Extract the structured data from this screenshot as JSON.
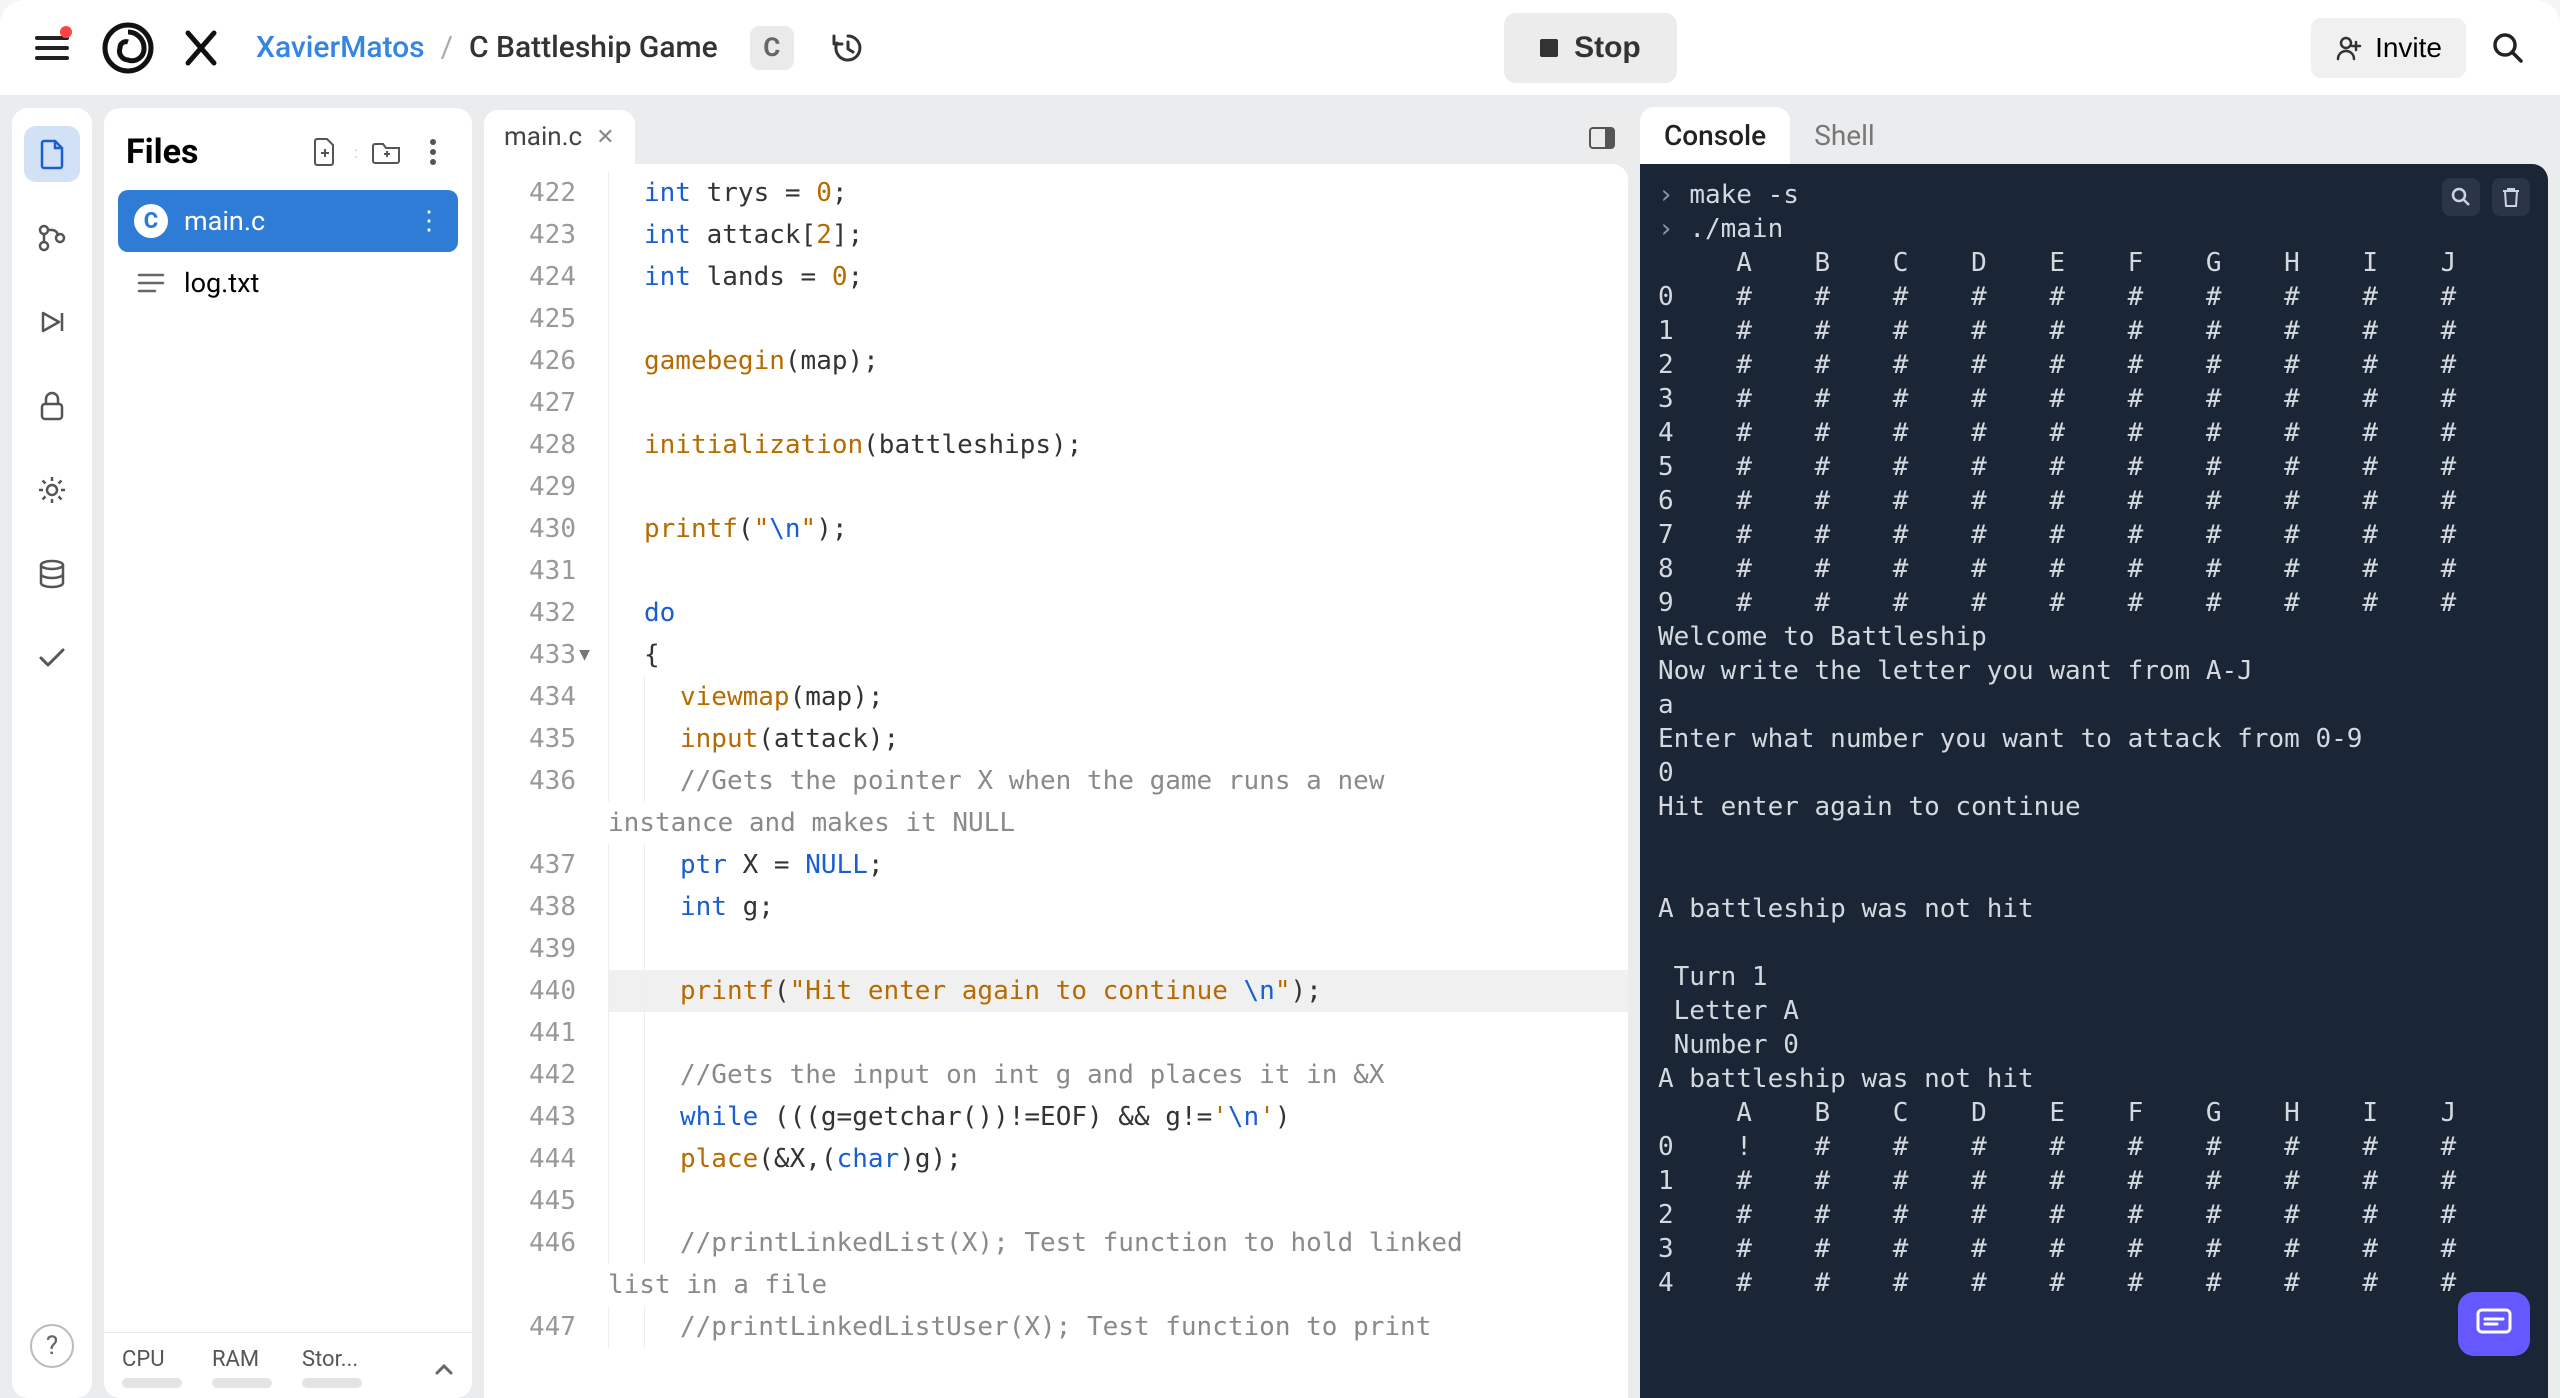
{
  "header": {
    "user": "XavierMatos",
    "separator": "/",
    "project": "C Battleship Game",
    "lang_badge": "C",
    "stop_label": "Stop",
    "invite_label": "Invite"
  },
  "files_panel": {
    "title": "Files",
    "items": [
      {
        "name": "main.c",
        "kind": "c",
        "active": true
      },
      {
        "name": "log.txt",
        "kind": "txt",
        "active": false
      }
    ],
    "stats": {
      "cpu": "CPU",
      "ram": "RAM",
      "storage": "Stor..."
    }
  },
  "editor": {
    "tab_label": "main.c",
    "lines": [
      {
        "n": 422,
        "html": "<span class='c-kw'>int</span> trys = <span class='c-num'>0</span>;",
        "indent": 1
      },
      {
        "n": 423,
        "html": "<span class='c-kw'>int</span> attack[<span class='c-num'>2</span>];",
        "indent": 1
      },
      {
        "n": 424,
        "html": "<span class='c-kw'>int</span> lands = <span class='c-num'>0</span>;",
        "indent": 1
      },
      {
        "n": 425,
        "html": "",
        "indent": 1
      },
      {
        "n": 426,
        "html": "<span class='c-fn'>gamebegin</span>(map);",
        "indent": 1
      },
      {
        "n": 427,
        "html": "",
        "indent": 1
      },
      {
        "n": 428,
        "html": "<span class='c-fn'>initialization</span>(battleships);",
        "indent": 1
      },
      {
        "n": 429,
        "html": "",
        "indent": 1
      },
      {
        "n": 430,
        "html": "<span class='c-fn'>printf</span>(<span class='c-str'>\"</span><span class='c-esc'>\\n</span><span class='c-str'>\"</span>);",
        "indent": 1
      },
      {
        "n": 431,
        "html": "",
        "indent": 1
      },
      {
        "n": 432,
        "html": "<span class='c-kw'>do</span>",
        "indent": 1
      },
      {
        "n": 433,
        "html": "{",
        "indent": 1,
        "fold": true
      },
      {
        "n": 434,
        "html": "<span class='c-fn'>viewmap</span>(map);",
        "indent": 2
      },
      {
        "n": 435,
        "html": "<span class='c-fn'>input</span>(attack);",
        "indent": 2
      },
      {
        "n": 436,
        "html": "<span class='c-cmt'>//Gets the pointer X when the game runs a new</span>",
        "indent": 2,
        "wrap": "instance and makes it NULL"
      },
      {
        "n": 437,
        "html": "<span class='c-type'>ptr</span> X = <span class='c-kw'>NULL</span>;",
        "indent": 2
      },
      {
        "n": 438,
        "html": "<span class='c-kw'>int</span> g;",
        "indent": 2
      },
      {
        "n": 439,
        "html": "",
        "indent": 2
      },
      {
        "n": 440,
        "html": "<span class='c-fn'>printf</span>(<span class='c-str'>\"Hit enter again to continue </span><span class='c-esc'>\\n</span><span class='c-str'>\"</span>);",
        "indent": 2,
        "hl": true
      },
      {
        "n": 441,
        "html": "",
        "indent": 2
      },
      {
        "n": 442,
        "html": "<span class='c-cmt'>//Gets the input on int g and places it in &X</span>",
        "indent": 2
      },
      {
        "n": 443,
        "html": "<span class='c-kw'>while</span> (((g=getchar())!=EOF) && g!=<span class='c-str'>'</span><span class='c-esc'>\\n</span><span class='c-str'>'</span>)",
        "indent": 2
      },
      {
        "n": 444,
        "html": "<span class='c-fn'>place</span>(&X,(<span class='c-kw'>char</span>)g);",
        "indent": 2
      },
      {
        "n": 445,
        "html": "",
        "indent": 2
      },
      {
        "n": 446,
        "html": "<span class='c-cmt'>//printLinkedList(X); Test function to hold linked</span>",
        "indent": 2,
        "wrap": "list in a file"
      },
      {
        "n": 447,
        "html": "<span class='c-cmt'>//printLinkedListUser(X); Test function to print</span>",
        "indent": 2
      }
    ]
  },
  "console": {
    "tabs": [
      "Console",
      "Shell"
    ],
    "active_tab": 0,
    "cmd1": "make -s",
    "cmd2": "./main",
    "output": "     A    B    C    D    E    F    G    H    I    J\n0    #    #    #    #    #    #    #    #    #    #\n1    #    #    #    #    #    #    #    #    #    #\n2    #    #    #    #    #    #    #    #    #    #\n3    #    #    #    #    #    #    #    #    #    #\n4    #    #    #    #    #    #    #    #    #    #\n5    #    #    #    #    #    #    #    #    #    #\n6    #    #    #    #    #    #    #    #    #    #\n7    #    #    #    #    #    #    #    #    #    #\n8    #    #    #    #    #    #    #    #    #    #\n9    #    #    #    #    #    #    #    #    #    #\nWelcome to Battleship\nNow write the letter you want from A-J\na\nEnter what number you want to attack from 0-9\n0\nHit enter again to continue\n\n\nA battleship was not hit\n\n Turn 1\n Letter A\n Number 0\nA battleship was not hit\n     A    B    C    D    E    F    G    H    I    J\n0    !    #    #    #    #    #    #    #    #    #\n1    #    #    #    #    #    #    #    #    #    #\n2    #    #    #    #    #    #    #    #    #    #\n3    #    #    #    #    #    #    #    #    #    #\n4    #    #    #    #    #    #    #    #    #    #"
  }
}
